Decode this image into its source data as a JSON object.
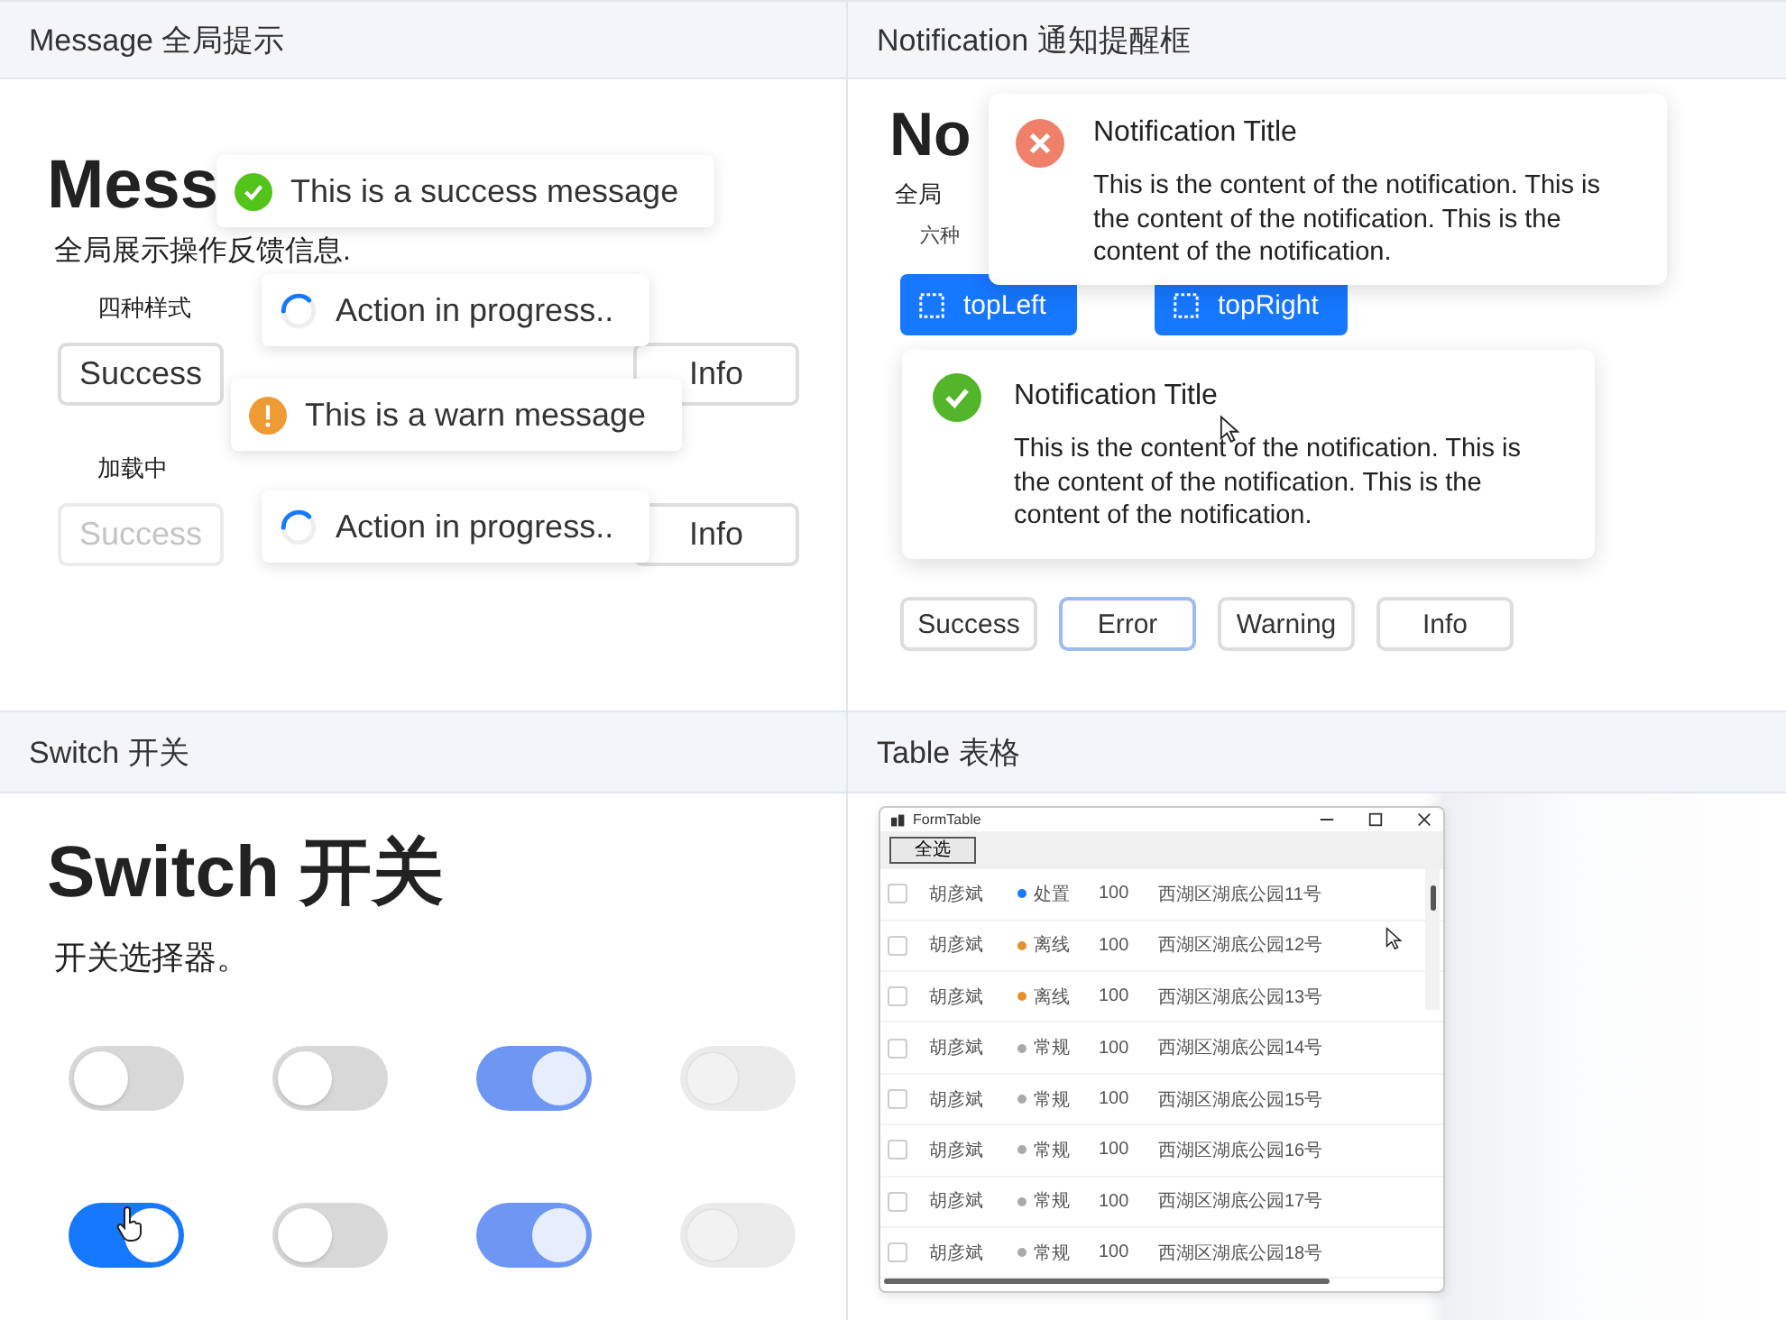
{
  "message": {
    "header": "Message 全局提示",
    "heading": "Mess",
    "description": "全局展示操作反馈信息.",
    "groups": [
      {
        "label": "四种样式",
        "buttons": [
          {
            "label": "Success",
            "disabled": false
          },
          {
            "label": "Info",
            "disabled": false
          }
        ]
      },
      {
        "label": "加载中",
        "buttons": [
          {
            "label": "Success",
            "disabled": true
          },
          {
            "label": "Info",
            "disabled": false
          }
        ]
      }
    ],
    "toasts": [
      {
        "kind": "success",
        "text": "This is a success message"
      },
      {
        "kind": "loading",
        "text": "Action in progress.."
      },
      {
        "kind": "warning",
        "text": "This is a warn message"
      },
      {
        "kind": "loading",
        "text": "Action in progress.."
      }
    ]
  },
  "notification": {
    "header": "Notification 通知提醒框",
    "heading": "No",
    "description": "全局",
    "sublabel": "六种",
    "position_buttons": [
      {
        "label": "topLeft"
      },
      {
        "label": "topRight"
      }
    ],
    "cards": [
      {
        "kind": "error",
        "title": "Notification Title",
        "content": "This is the content of the notification. This is the content of the notification. This is the content of the notification."
      },
      {
        "kind": "success",
        "title": "Notification Title",
        "content": "This is the content of the notification. This is the content of the notification. This is the content of the notification."
      }
    ],
    "type_buttons": [
      {
        "label": "Success",
        "focused": false
      },
      {
        "label": "Error",
        "focused": true
      },
      {
        "label": "Warning",
        "focused": false
      },
      {
        "label": "Info",
        "focused": false
      }
    ]
  },
  "switch": {
    "header": "Switch 开关",
    "heading": "Switch 开关",
    "description": "开关选择器。",
    "switches": [
      {
        "on": false,
        "disabled": false
      },
      {
        "on": false,
        "disabled": false
      },
      {
        "on": true,
        "disabled": true
      },
      {
        "on": false,
        "disabled": true
      },
      {
        "on": true,
        "disabled": false
      },
      {
        "on": false,
        "disabled": false
      },
      {
        "on": true,
        "disabled": true
      },
      {
        "on": false,
        "disabled": true
      }
    ]
  },
  "table": {
    "header": "Table 表格",
    "window": {
      "title": "FormTable"
    },
    "select_all": "全选",
    "rows": [
      {
        "checked": false,
        "name": "胡彦斌",
        "status": "处置",
        "color": "#1677ff",
        "value": "100",
        "address": "西湖区湖底公园11号"
      },
      {
        "checked": false,
        "name": "胡彦斌",
        "status": "离线",
        "color": "#e6912c",
        "value": "100",
        "address": "西湖区湖底公园12号"
      },
      {
        "checked": false,
        "name": "胡彦斌",
        "status": "离线",
        "color": "#e6912c",
        "value": "100",
        "address": "西湖区湖底公园13号"
      },
      {
        "checked": false,
        "name": "胡彦斌",
        "status": "常规",
        "color": "#aaaaaa",
        "value": "100",
        "address": "西湖区湖底公园14号"
      },
      {
        "checked": false,
        "name": "胡彦斌",
        "status": "常规",
        "color": "#aaaaaa",
        "value": "100",
        "address": "西湖区湖底公园15号"
      },
      {
        "checked": false,
        "name": "胡彦斌",
        "status": "常规",
        "color": "#aaaaaa",
        "value": "100",
        "address": "西湖区湖底公园16号"
      },
      {
        "checked": false,
        "name": "胡彦斌",
        "status": "常规",
        "color": "#aaaaaa",
        "value": "100",
        "address": "西湖区湖底公园17号"
      },
      {
        "checked": false,
        "name": "胡彦斌",
        "status": "常规",
        "color": "#aaaaaa",
        "value": "100",
        "address": "西湖区湖底公园18号"
      }
    ]
  }
}
